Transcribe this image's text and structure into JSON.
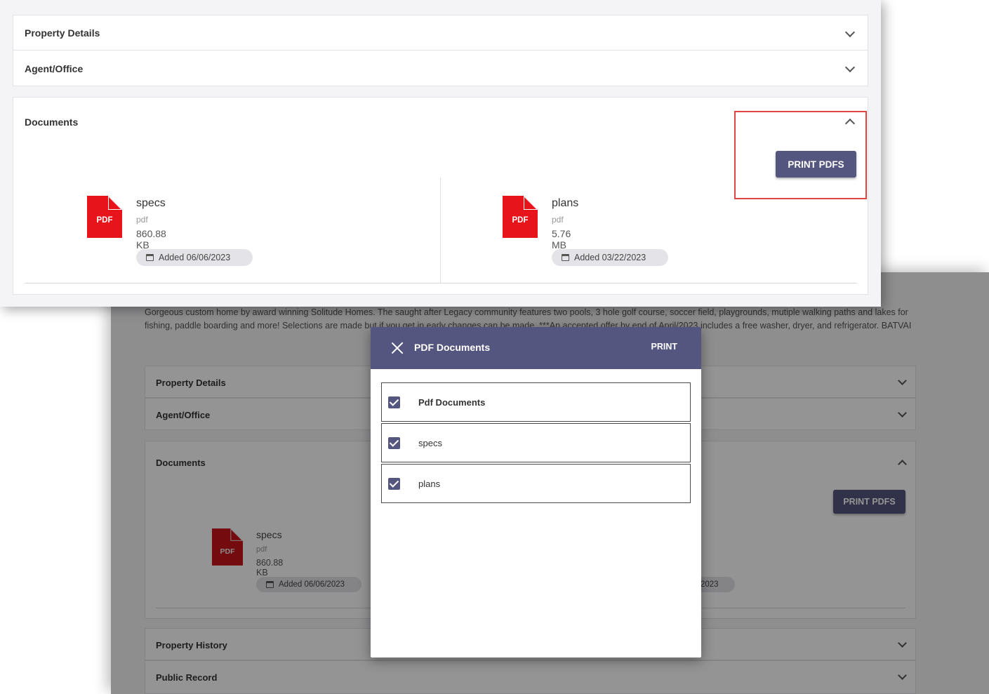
{
  "front": {
    "panels": {
      "property_details": "Property Details",
      "agent_office": "Agent/Office",
      "documents": "Documents"
    },
    "print_pdfs_label": "PRINT PDFS",
    "documents": [
      {
        "name": "specs",
        "type": "pdf",
        "size": "860.88 KB",
        "added": "Added 06/06/2023"
      },
      {
        "name": "plans",
        "type": "pdf",
        "size": "5.76 MB",
        "added": "Added 03/22/2023"
      }
    ]
  },
  "back": {
    "description": "Gorgeous custom home by award winning Solitude Homes. The saught after Legacy community features two pools, 3 hole golf course, soccer field, playgrounds, mutiple walking paths and lakes for fishing, paddle boarding and more! Selections are made but if you get in early changes can be made. ***An accepted offer by end of April/2023 includes a free washer, dryer, and refrigerator. BATVAI",
    "panels": {
      "property_details": "Property Details",
      "agent_office": "Agent/Office",
      "documents": "Documents",
      "property_history": "Property History",
      "public_record": "Public Record"
    },
    "print_pdfs_label": "PRINT PDFS",
    "documents": [
      {
        "name": "specs",
        "type": "pdf",
        "size": "860.88 KB",
        "added": "Added 06/06/2023"
      }
    ],
    "partial_chip": "2023"
  },
  "modal": {
    "title": "PDF Documents",
    "print_label": "PRINT",
    "items": [
      {
        "label": "Pdf Documents",
        "checked": true
      },
      {
        "label": "specs",
        "checked": true
      },
      {
        "label": "plans",
        "checked": true
      }
    ]
  },
  "pdf_icon_label": "PDF",
  "colors": {
    "accent": "#55567f",
    "pdf_red": "#e8141b",
    "highlight": "#e0453f"
  }
}
